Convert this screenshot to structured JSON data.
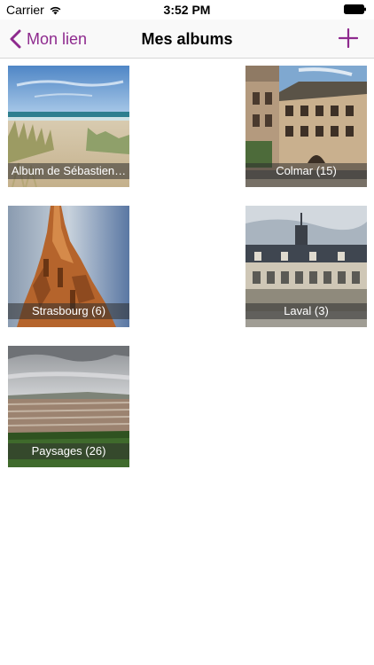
{
  "status_bar": {
    "carrier": "Carrier",
    "time": "3:52 PM"
  },
  "nav_bar": {
    "back_label": "Mon lien",
    "title": "Mes albums",
    "accent_color": "#8e2a8e"
  },
  "albums": [
    {
      "label": "Album de Sébastien…",
      "image": "beach-dunes-photo"
    },
    {
      "label": "Colmar (15)",
      "image": "colmar-building-photo"
    },
    {
      "label": "Strasbourg (6)",
      "image": "cathedral-spire-photo"
    },
    {
      "label": "Laval (3)",
      "image": "chateau-facade-photo"
    },
    {
      "label": "Paysages (26)",
      "image": "town-landscape-photo"
    }
  ]
}
